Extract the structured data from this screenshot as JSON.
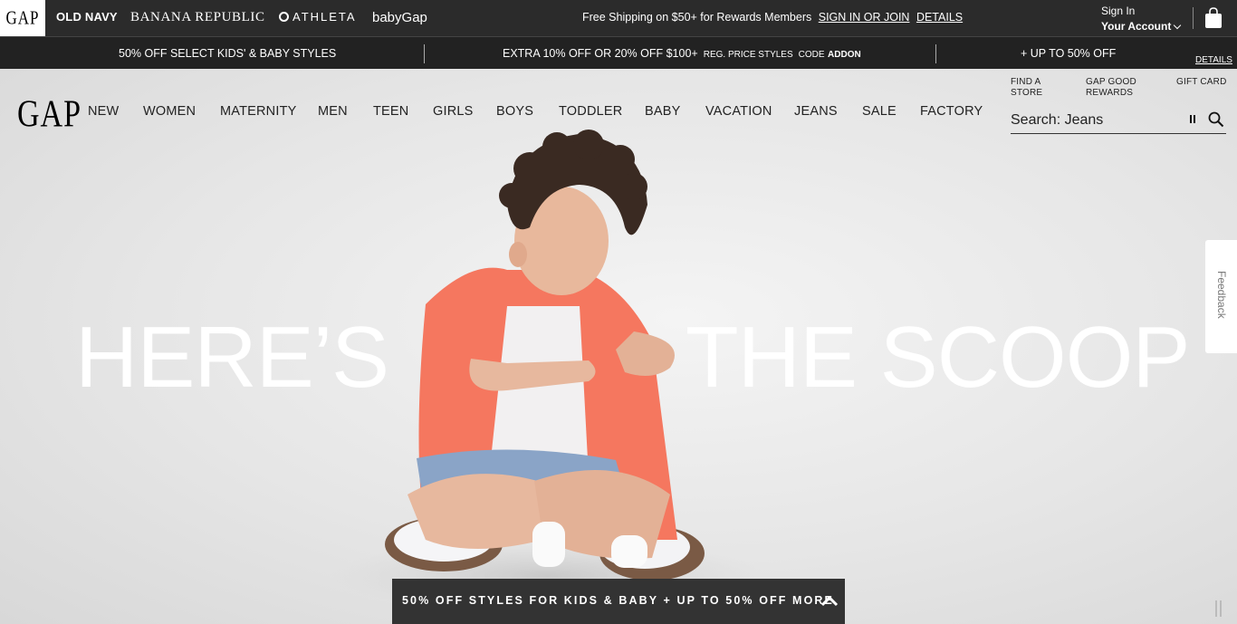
{
  "brands": {
    "gap": "GAP",
    "old_navy": "OLD NAVY",
    "banana_republic": "BANANA REPUBLIC",
    "athleta": "ATHLETA",
    "babygap": "babyGap"
  },
  "topbar": {
    "shipping_text": "Free Shipping on $50+ for Rewards Members",
    "sign_in_link": "SIGN IN OR JOIN",
    "details_link": "DETAILS",
    "account_line1": "Sign In",
    "account_line2": "Your Account"
  },
  "promobar": {
    "promo1": "50% OFF SELECT KIDS' & BABY STYLES",
    "promo2_main": "EXTRA 10% OFF OR 20% OFF $100+",
    "promo2_small": "REG. PRICE STYLES",
    "promo2_code_label": "CODE",
    "promo2_code": "ADDON",
    "promo3": "+ UP TO 50% OFF",
    "details": "DETAILS"
  },
  "header": {
    "logo": "GAP",
    "nav": [
      "NEW",
      "WOMEN",
      "MATERNITY",
      "MEN",
      "TEEN",
      "GIRLS",
      "BOYS",
      "TODDLER",
      "BABY",
      "VACATION",
      "JEANS",
      "SALE",
      "FACTORY"
    ],
    "util_find_store_1": "FIND A",
    "util_find_store_2": "STORE",
    "util_rewards_1": "GAP GOOD",
    "util_rewards_2": "REWARDS",
    "util_gift_card": "GIFT CARD",
    "search_text": "Search: Jeans"
  },
  "hero": {
    "headline_left": "HERE’S",
    "headline_right": "THE SCOOP"
  },
  "feedback": {
    "label": "Feedback"
  },
  "drawer": {
    "text": "50% OFF STYLES FOR KIDS & BABY + UP TO 50% OFF MORE"
  }
}
